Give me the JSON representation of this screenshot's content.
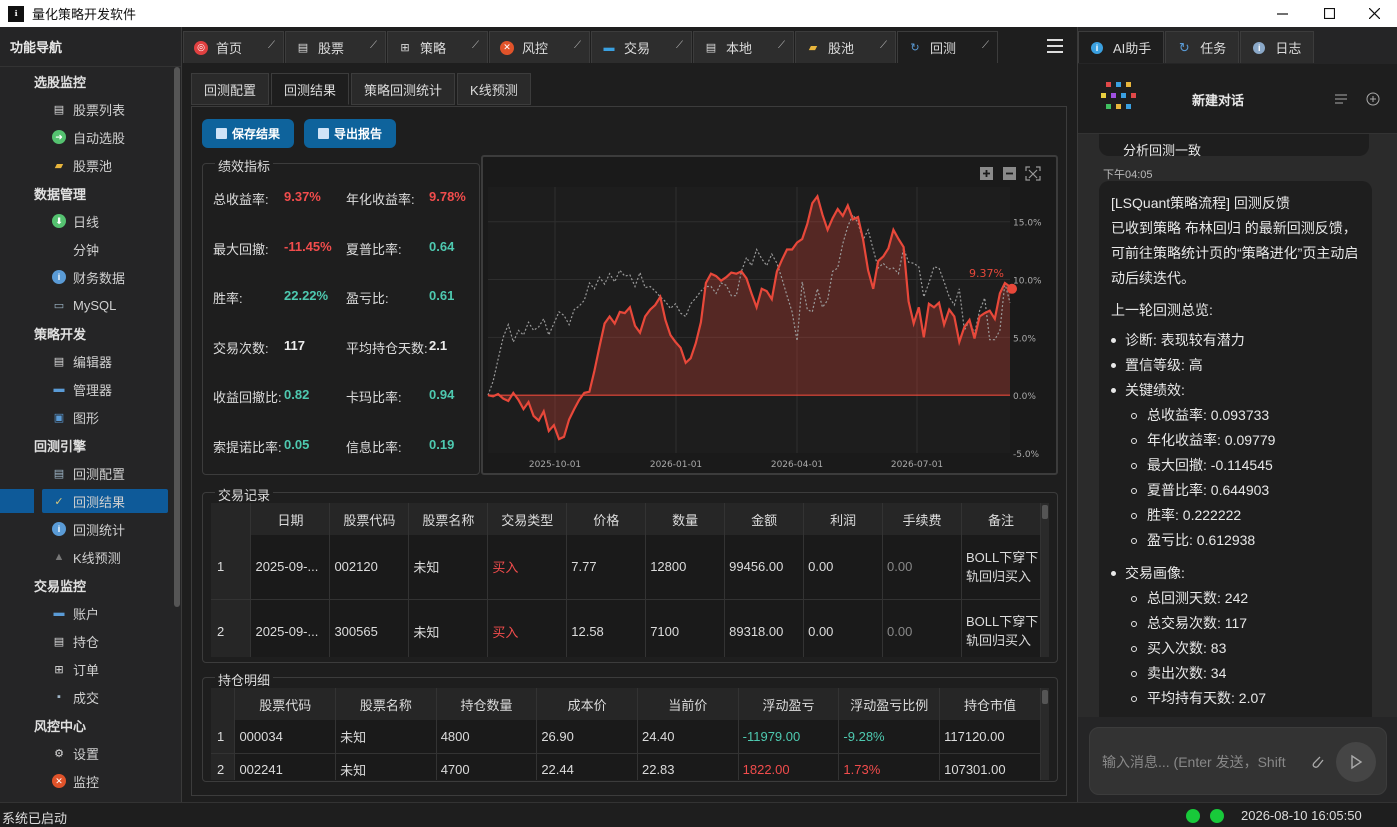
{
  "window": {
    "title": "量化策略开发软件",
    "logo": "ℹ"
  },
  "sidebar": {
    "header": "功能导航",
    "groups": [
      {
        "label": "选股监控",
        "items": [
          {
            "label": "股票列表",
            "icon": "document-icon",
            "color": "#dcdcdc"
          },
          {
            "label": "自动选股",
            "icon": "arrow-right-icon",
            "color": "#55c270"
          },
          {
            "label": "股票池",
            "icon": "folder-icon",
            "color": "#e8b53c"
          }
        ]
      },
      {
        "label": "数据管理",
        "items": [
          {
            "label": "日线",
            "icon": "download-icon",
            "color": "#55c270"
          },
          {
            "label": "分钟",
            "icon": "",
            "color": ""
          },
          {
            "label": "财务数据",
            "icon": "info-icon",
            "color": "#5a9bd6"
          },
          {
            "label": "MySQL",
            "icon": "computer-icon",
            "color": "#9fb6c8"
          }
        ]
      },
      {
        "label": "策略开发",
        "items": [
          {
            "label": "编辑器",
            "icon": "document-icon",
            "color": "#dcdcdc"
          },
          {
            "label": "管理器",
            "icon": "window-icon",
            "color": "#5a9bd6"
          },
          {
            "label": "图形",
            "icon": "image-icon",
            "color": "#5a9bd6"
          }
        ]
      },
      {
        "label": "回测引擎",
        "items": [
          {
            "label": "回测配置",
            "icon": "settings-file-icon",
            "color": "#9fb6c8"
          },
          {
            "label": "回测结果",
            "icon": "check-icon",
            "color": "#d8c77a",
            "active": true
          },
          {
            "label": "回测统计",
            "icon": "info-icon",
            "color": "#5a9bd6"
          },
          {
            "label": "K线预测",
            "icon": "triangle-icon",
            "color": "#777777"
          }
        ]
      },
      {
        "label": "交易监控",
        "items": [
          {
            "label": "账户",
            "icon": "window-icon",
            "color": "#5a9bd6"
          },
          {
            "label": "持仓",
            "icon": "document-icon",
            "color": "#dcdcdc"
          },
          {
            "label": "订单",
            "icon": "grid-icon",
            "color": "#dcdcdc"
          },
          {
            "label": "成交",
            "icon": "save-icon",
            "color": "#9fb6c8"
          }
        ]
      },
      {
        "label": "风控中心",
        "items": [
          {
            "label": "设置",
            "icon": "gear-icon",
            "color": "#dcdcdc"
          },
          {
            "label": "监控",
            "icon": "stop-icon",
            "color": "#e0532a"
          }
        ]
      }
    ]
  },
  "main_tabs": [
    {
      "label": "首页",
      "icon": "lifebuoy-icon",
      "color": "#e04040"
    },
    {
      "label": "股票",
      "icon": "document-icon",
      "color": "#dcdcdc"
    },
    {
      "label": "策略",
      "icon": "grid-icon",
      "color": "#dcdcdc"
    },
    {
      "label": "风控",
      "icon": "stop-icon",
      "color": "#e0532a"
    },
    {
      "label": "交易",
      "icon": "monitor-icon",
      "color": "#3aa0e0"
    },
    {
      "label": "本地",
      "icon": "document-icon",
      "color": "#dcdcdc"
    },
    {
      "label": "股池",
      "icon": "folder-icon",
      "color": "#e8b53c"
    },
    {
      "label": "回测",
      "icon": "refresh-icon",
      "color": "#5a9bd6",
      "active": true
    }
  ],
  "sub_tabs": [
    {
      "label": "回测配置"
    },
    {
      "label": "回测结果",
      "active": true
    },
    {
      "label": "策略回测统计"
    },
    {
      "label": "K线预测"
    }
  ],
  "toolbar": {
    "save_label": "保存结果",
    "export_label": "导出报告"
  },
  "metrics": {
    "title": "绩效指标",
    "rows": [
      [
        {
          "label": "总收益率:",
          "value": "9.37%",
          "tone": "red"
        },
        {
          "label": "年化收益率:",
          "value": "9.78%",
          "tone": "red"
        }
      ],
      [
        {
          "label": "最大回撤:",
          "value": "-11.45%",
          "tone": "red"
        },
        {
          "label": "夏普比率:",
          "value": "0.64",
          "tone": "green"
        }
      ],
      [
        {
          "label": "胜率:",
          "value": "22.22%",
          "tone": "green"
        },
        {
          "label": "盈亏比:",
          "value": "0.61",
          "tone": "green"
        }
      ],
      [
        {
          "label": "交易次数:",
          "value": "117",
          "tone": "white"
        },
        {
          "label": "平均持仓天数:",
          "value": "2.1",
          "tone": "white"
        }
      ],
      [
        {
          "label": "收益回撤比:",
          "value": "0.82",
          "tone": "green"
        },
        {
          "label": "卡玛比率:",
          "value": "0.94",
          "tone": "green"
        }
      ],
      [
        {
          "label": "索提诺比率:",
          "value": "0.05",
          "tone": "green"
        },
        {
          "label": "信息比率:",
          "value": "0.19",
          "tone": "green"
        }
      ]
    ]
  },
  "chart_data": {
    "type": "line",
    "title": "",
    "xlabel": "",
    "ylabel": "",
    "x_ticks": [
      "2025-10-01",
      "2026-01-01",
      "2026-04-01",
      "2026-07-01"
    ],
    "y_ticks": [
      "15.0%",
      "10.0%",
      "5.0%",
      "0.0%",
      "-5.0%"
    ],
    "ylim": [
      -5,
      18
    ],
    "end_label": "9.37%",
    "series": [
      {
        "role": "strategy",
        "color": "#e8483a",
        "values": [
          0,
          -0.1,
          0.1,
          -0.3,
          -0.5,
          0.2,
          -0.4,
          -1.2,
          -0.6,
          -1.8,
          -2.2,
          -1.4,
          -3.1,
          -2.6,
          -3.8,
          -3.6,
          -2.1,
          -1.2,
          -0.4,
          0.2,
          0.3,
          2.1,
          4.2,
          6.2,
          6.8,
          6.2,
          7.2,
          7.1,
          7.6,
          6.0,
          5.4,
          6.8,
          7.4,
          7.8,
          8.5,
          6.5,
          5.2,
          4.6,
          4.1,
          2.8,
          3.2,
          4.5,
          6.3,
          9.7,
          10.5,
          10.3,
          9.9,
          10.2,
          10.6,
          10.5,
          10.7,
          10.1,
          8.8,
          7.6,
          9.2,
          9.0,
          8.3,
          10.7,
          11.7,
          12.6,
          12.6,
          13.2,
          13.5,
          14.8,
          16.6,
          17.2,
          15.6,
          14.3,
          15.3,
          16.1,
          15.5,
          16.4,
          15.2,
          15.4,
          13.5,
          10.8,
          9.2,
          11.6,
          12.0,
          12.7,
          14.3,
          13.5,
          12.8,
          8.1,
          6.2,
          7.6,
          5.0,
          7.9,
          7.6,
          8.0,
          6.1,
          7.4,
          6.8,
          4.6,
          5.9,
          6.5,
          4.9,
          6.8,
          7.1,
          7.3,
          6.6,
          8.8,
          9.7,
          9.37
        ]
      },
      {
        "role": "benchmark",
        "color": "#9a9a9a",
        "values": [
          0,
          1.2,
          3.1,
          5.0,
          6.1,
          4.6,
          5.6,
          5.2,
          6.3,
          5.6,
          5.9,
          6.6,
          5.2,
          6.2,
          7.2,
          6.9,
          6.1,
          7.4,
          7.7,
          8.2,
          9.7,
          9.2,
          10.2,
          9.6,
          10.5,
          9.8,
          10.8,
          10.3,
          10.4,
          9.4,
          10.6,
          9.3,
          9.4,
          9.0,
          8.5,
          8.1,
          7.5,
          7.9,
          7.1,
          6.8,
          7.9,
          8.4,
          9.0,
          9.4,
          9.4,
          8.8,
          9.7,
          9.5,
          8.6,
          8.6,
          10.7,
          11.9,
          11.2,
          12.6,
          11.8,
          11.2,
          12.2,
          11.4,
          10.1,
          8.6,
          7.2,
          4.7,
          9.8,
          7.4,
          7.2,
          9.2,
          7.6,
          8.2,
          10.7,
          11.0,
          13.1,
          14.6,
          15.6,
          14.9,
          13.4,
          14.3,
          12.6,
          11.0,
          11.4,
          10.9,
          11.0,
          10.5,
          12.7,
          11.5,
          11.4,
          11.1,
          8.5,
          9.7,
          11.1,
          11.0,
          9.8,
          8.5,
          7.8,
          9.2,
          5.6,
          6.5,
          5.3,
          7.3,
          8.4,
          4.8,
          4.8,
          5.6,
          9.7,
          8.0
        ]
      }
    ],
    "zoom_in_icon": "plus-icon",
    "zoom_out_icon": "minus-icon",
    "fit_icon": "fit-icon"
  },
  "trades": {
    "title": "交易记录",
    "columns": [
      "日期",
      "股票代码",
      "股票名称",
      "交易类型",
      "价格",
      "数量",
      "金额",
      "利润",
      "手续费",
      "备注"
    ],
    "rows": [
      {
        "num": "1",
        "date": "2025-09-...",
        "code": "002120",
        "name": "未知",
        "type": "买入",
        "price": "7.77",
        "qty": "12800",
        "amount": "99456.00",
        "profit": "0.00",
        "fee": "0.00",
        "note": "BOLL下穿下轨回归买入"
      },
      {
        "num": "2",
        "date": "2025-09-...",
        "code": "300565",
        "name": "未知",
        "type": "买入",
        "price": "12.58",
        "qty": "7100",
        "amount": "89318.00",
        "profit": "0.00",
        "fee": "0.00",
        "note": "BOLL下穿下轨回归买入"
      }
    ]
  },
  "positions": {
    "title": "持仓明细",
    "columns": [
      "股票代码",
      "股票名称",
      "持仓数量",
      "成本价",
      "当前价",
      "浮动盈亏",
      "浮动盈亏比例",
      "持仓市值"
    ],
    "rows": [
      {
        "num": "1",
        "code": "000034",
        "name": "未知",
        "qty": "4800",
        "cost": "26.90",
        "price": "24.40",
        "pnl": "-11979.00",
        "pnl_pct": "-9.28%",
        "value": "117120.00",
        "tone": "green"
      },
      {
        "num": "2",
        "code": "002241",
        "name": "未知",
        "qty": "4700",
        "cost": "22.44",
        "price": "22.83",
        "pnl": "1822.00",
        "pnl_pct": "1.73%",
        "value": "107301.00",
        "tone": "red"
      }
    ]
  },
  "right_tabs": [
    {
      "label": "AI助手",
      "icon": "info-icon",
      "color": "#3aa0e0",
      "active": true
    },
    {
      "label": "任务",
      "icon": "refresh-icon",
      "color": "#5a9bd6"
    },
    {
      "label": "日志",
      "icon": "info-icon",
      "color": "#8aa8c8"
    }
  ],
  "chat": {
    "title": "新建对话",
    "prev_tail": "分析回测一致",
    "time": "下午04:05",
    "heading": "[LSQuant策略流程] 回测反馈",
    "intro": "已收到策略 布林回归 的最新回测反馈，可前往策略统计页的“策略进化”页主动启动后续迭代。",
    "overview": "上一轮回测总览:",
    "items": [
      {
        "label": "诊断: 表现较有潜力"
      },
      {
        "label": "置信等级: 高"
      },
      {
        "label": "关键绩效:",
        "sub": [
          "总收益率: 0.093733",
          "年化收益率: 0.09779",
          "最大回撤: -0.114545",
          "夏普比率: 0.644903",
          "胜率: 0.222222",
          "盈亏比: 0.612938"
        ]
      },
      {
        "label": "交易画像:",
        "sub": [
          "总回测天数: 242",
          "总交易次数: 117",
          "买入次数: 83",
          "卖出次数: 34",
          "平均持有天数: 2.07"
        ]
      }
    ],
    "input_placeholder": "输入消息... (Enter 发送，Shift"
  },
  "status": {
    "left": "系统已启动",
    "datetime": "2026-08-10 16:05:50"
  }
}
